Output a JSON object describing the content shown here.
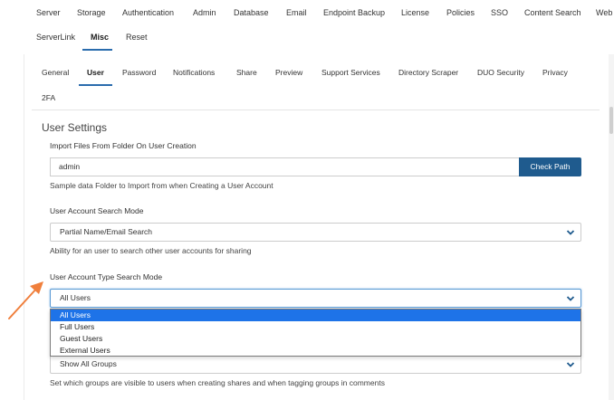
{
  "top_nav": {
    "row1": [
      "Server",
      "Storage",
      "Authentication",
      "Admin",
      "Database",
      "Email",
      "Endpoint Backup",
      "License",
      "Policies",
      "SSO",
      "Content Search",
      "Web"
    ],
    "row2": [
      "ServerLink",
      "Misc",
      "Reset"
    ],
    "active": "Misc"
  },
  "sub_tabs": {
    "row1": [
      "General",
      "User",
      "Password",
      "Notifications",
      "Share",
      "Preview",
      "Support Services",
      "Directory Scraper",
      "DUO Security",
      "Privacy"
    ],
    "row2": [
      "2FA"
    ],
    "active": "User"
  },
  "section_title": "User Settings",
  "import_folder": {
    "label": "Import Files From Folder On User Creation",
    "value": "admin",
    "button": "Check Path",
    "help": "Sample data Folder to Import from when Creating a User Account"
  },
  "search_mode": {
    "label": "User Account Search Mode",
    "value": "Partial Name/Email Search",
    "help": "Ability for an user to search other user accounts for sharing"
  },
  "type_search_mode": {
    "label": "User Account Type Search Mode",
    "value": "All Users",
    "options": [
      "All Users",
      "Full Users",
      "Guest Users",
      "External Users"
    ],
    "selected_index": 0
  },
  "groups_visibility": {
    "value": "Show All Groups",
    "help": "Set which groups are visible to users when creating shares and when tagging groups in comments"
  },
  "colors": {
    "accent": "#1f5b8e",
    "selection": "#1e73e8",
    "annotation_arrow": "#f07f3c"
  },
  "icons": {
    "dropdown": "chevron-down-icon",
    "annotation": "arrow-icon"
  }
}
